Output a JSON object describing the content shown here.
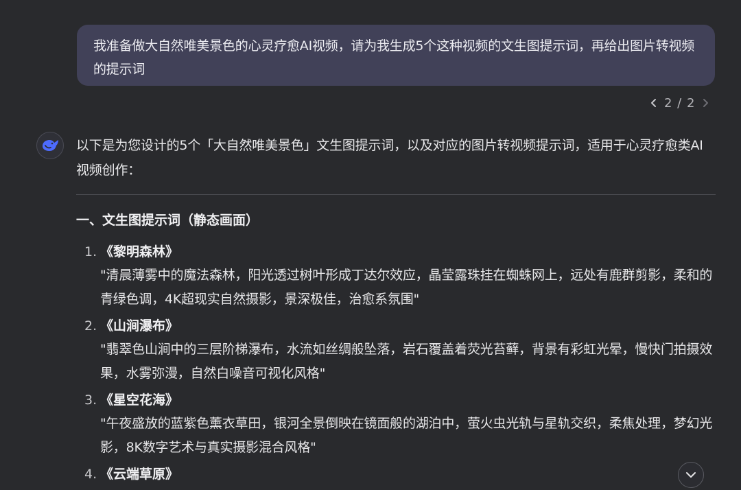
{
  "user_message": {
    "text": "我准备做大自然唯美景色的心灵疗愈AI视频，请为我生成5个这种视频的文生图提示词，再给出图片转视频的提示词"
  },
  "pager": {
    "count": "2 / 2"
  },
  "assistant": {
    "intro": "以下是为您设计的5个「大自然唯美景色」文生图提示词，以及对应的图片转视频提示词，适用于心灵疗愈类AI视频创作：",
    "section_title": "一、文生图提示词（静态画面）",
    "items": [
      {
        "num": "1.",
        "title": "《黎明森林》",
        "desc": "\"清晨薄雾中的魔法森林，阳光透过树叶形成丁达尔效应，晶莹露珠挂在蜘蛛网上，远处有鹿群剪影，柔和的青绿色调，4K超现实自然摄影，景深极佳，治愈系氛围\""
      },
      {
        "num": "2.",
        "title": "《山涧瀑布》",
        "desc": "\"翡翠色山涧中的三层阶梯瀑布，水流如丝绸般坠落，岩石覆盖着荧光苔藓，背景有彩虹光晕，慢快门拍摄效果，水雾弥漫，自然白噪音可视化风格\""
      },
      {
        "num": "3.",
        "title": "《星空花海》",
        "desc": "\"午夜盛放的蓝紫色薰衣草田，银河全景倒映在镜面般的湖泊中，萤火虫光轨与星轨交织，柔焦处理，梦幻光影，8K数字艺术与真实摄影混合风格\""
      },
      {
        "num": "4.",
        "title": "《云端草原》",
        "desc": ""
      }
    ]
  },
  "icons": {
    "prev": "chevron-left-icon",
    "next": "chevron-right-icon",
    "avatar": "whale-logo-icon",
    "scroll": "chevron-down-icon"
  },
  "colors": {
    "background": "#292a2d",
    "user_bubble": "#414158",
    "accent": "#4d6bfe"
  }
}
